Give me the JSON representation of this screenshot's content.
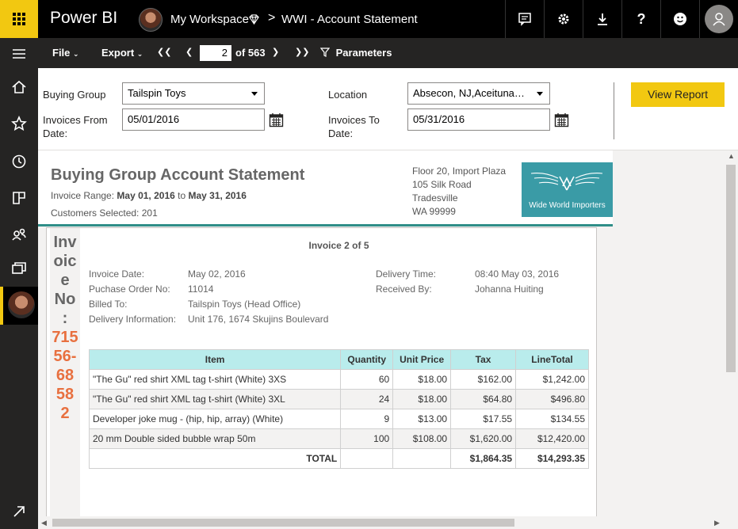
{
  "topbar": {
    "brand": "Power BI",
    "workspace": "My Workspace",
    "separator": ">",
    "report": "WWI - Account Statement",
    "icons": [
      "feedback-icon",
      "gear-icon",
      "download-icon",
      "help-icon",
      "smiley-icon",
      "user-icon"
    ]
  },
  "sidenav": {
    "icons": [
      "hamburger-icon",
      "home-icon",
      "star-icon",
      "recent-icon",
      "apps-icon",
      "shared-icon",
      "workspaces-icon",
      "workspace-avatar",
      "expand-icon"
    ]
  },
  "toolbar": {
    "file": "File",
    "export": "Export",
    "page_current": "2",
    "page_total": "of 563",
    "parameters": "Parameters"
  },
  "params": {
    "buying_group_label": "Buying Group",
    "buying_group_value": "Tailspin Toys",
    "location_label": "Location",
    "location_value": "Absecon, NJ,Aceituna…",
    "from_label_1": "Invoices From",
    "from_label_2": "Date:",
    "from_value": "05/01/2016",
    "to_label_1": "Invoices To",
    "to_label_2": "Date:",
    "to_value": "05/31/2016",
    "view_report": "View Report"
  },
  "report": {
    "title": "Buying Group Account Statement",
    "range_prefix": "Invoice Range:",
    "range_from": "May 01, 2016",
    "range_to_word": "to",
    "range_to": "May 31, 2016",
    "customers": "Customers Selected: 201",
    "address": [
      "Floor 20, Import Plaza",
      "105 Silk Road",
      "Tradesville",
      "WA 99999"
    ],
    "logo_text": "Wide World Importers",
    "accent_color": "#2f8e88"
  },
  "invoice": {
    "side_label": [
      "Inv",
      "oic",
      "e",
      "No",
      ":"
    ],
    "side_number": [
      "715",
      "56-",
      "68",
      "58",
      "2"
    ],
    "header": "Invoice 2 of 5",
    "fields_left": [
      {
        "label": "Invoice Date:",
        "value": "May 02, 2016"
      },
      {
        "label": "Puchase Order No:",
        "value": "11014"
      },
      {
        "label": "Billed To:",
        "value": "Tailspin Toys (Head Office)"
      },
      {
        "label": "Delivery Information:",
        "value": "Unit 176, 1674 Skujins Boulevard"
      }
    ],
    "fields_right": [
      {
        "label": "Delivery Time:",
        "value": "08:40 May 03, 2016"
      },
      {
        "label": "Received By:",
        "value": "Johanna Huiting"
      }
    ],
    "columns": [
      "Item",
      "Quantity",
      "Unit Price",
      "Tax",
      "LineTotal"
    ],
    "rows": [
      [
        "\"The Gu\" red shirt XML tag t-shirt (White) 3XS",
        "60",
        "$18.00",
        "$162.00",
        "$1,242.00"
      ],
      [
        "\"The Gu\" red shirt XML tag t-shirt (White) 3XL",
        "24",
        "$18.00",
        "$64.80",
        "$496.80"
      ],
      [
        "Developer joke mug - (hip, hip, array) (White)",
        "9",
        "$13.00",
        "$17.55",
        "$134.55"
      ],
      [
        "20 mm Double sided bubble wrap 50m",
        "100",
        "$108.00",
        "$1,620.00",
        "$12,420.00"
      ]
    ],
    "total_label": "TOTAL",
    "total_tax": "$1,864.35",
    "total_line": "$14,293.35"
  }
}
